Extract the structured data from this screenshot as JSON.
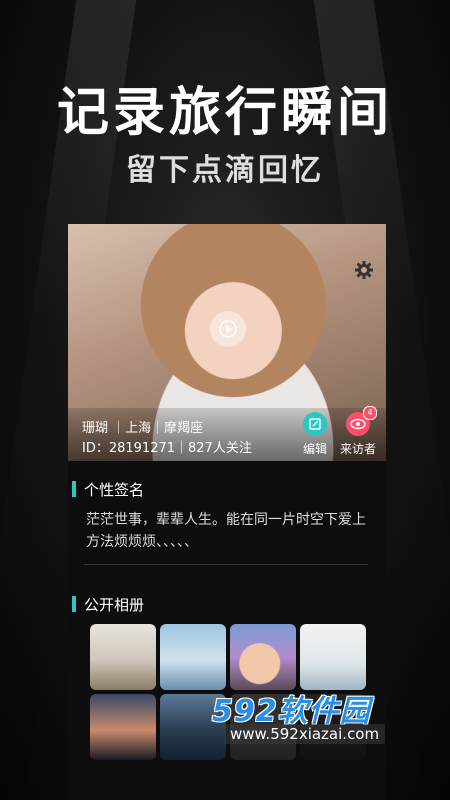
{
  "promo": {
    "headline": "记录旅行瞬间",
    "subline": "留下点滴回忆"
  },
  "profile": {
    "line1": "珊瑚  ｜上海｜摩羯座",
    "line2": "ID：28191271｜827人关注",
    "actions": {
      "edit_label": "编辑",
      "visitors_label": "来访者",
      "visitors_badge": "4"
    }
  },
  "signature": {
    "title": "个性签名",
    "text": "茫茫世事，辈辈人生。能在同一片时空下爱上方法烦烦烦、、、、、"
  },
  "album": {
    "title": "公开相册",
    "photos": [
      {
        "icon": "palm-trees-photo"
      },
      {
        "icon": "pier-ferris-wheel-photo"
      },
      {
        "icon": "baby-balloons-photo"
      },
      {
        "icon": "man-building-photo"
      },
      {
        "icon": "sunset-city-photo"
      },
      {
        "icon": "skyline-water-photo"
      },
      {
        "icon": "photo"
      },
      {
        "icon": "photo"
      }
    ]
  },
  "watermark": {
    "logo": "592软件园",
    "url": "www.592xiazai.com"
  },
  "colors": {
    "accent": "#2ec6c0",
    "visitor": "#ff4d6a",
    "watermark": "#2b8ee6"
  }
}
